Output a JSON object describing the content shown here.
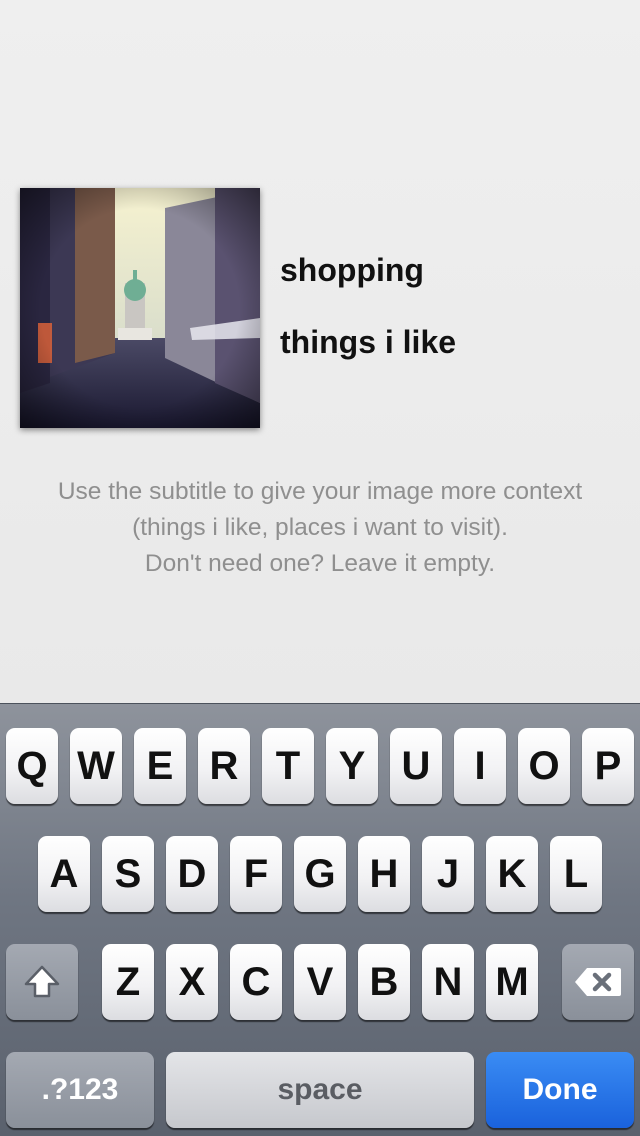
{
  "editor": {
    "image_alt": "street scene",
    "title": "shopping",
    "subtitle": "things i like",
    "hint_lines": [
      "Use the subtitle to give your image more context",
      "(things i like, places i want to visit).",
      "Don't need one? Leave it empty."
    ]
  },
  "keyboard": {
    "row1": [
      "Q",
      "W",
      "E",
      "R",
      "T",
      "Y",
      "U",
      "I",
      "O",
      "P"
    ],
    "row2": [
      "A",
      "S",
      "D",
      "F",
      "G",
      "H",
      "J",
      "K",
      "L"
    ],
    "row3": [
      "Z",
      "X",
      "C",
      "V",
      "B",
      "N",
      "M"
    ],
    "mode_label": ".?123",
    "space_label": "space",
    "done_label": "Done",
    "shift_icon": "shift-icon",
    "delete_icon": "delete-icon",
    "colors": {
      "done": "#1f6fe6",
      "key": "#ffffff",
      "background": "#6f7682"
    }
  }
}
